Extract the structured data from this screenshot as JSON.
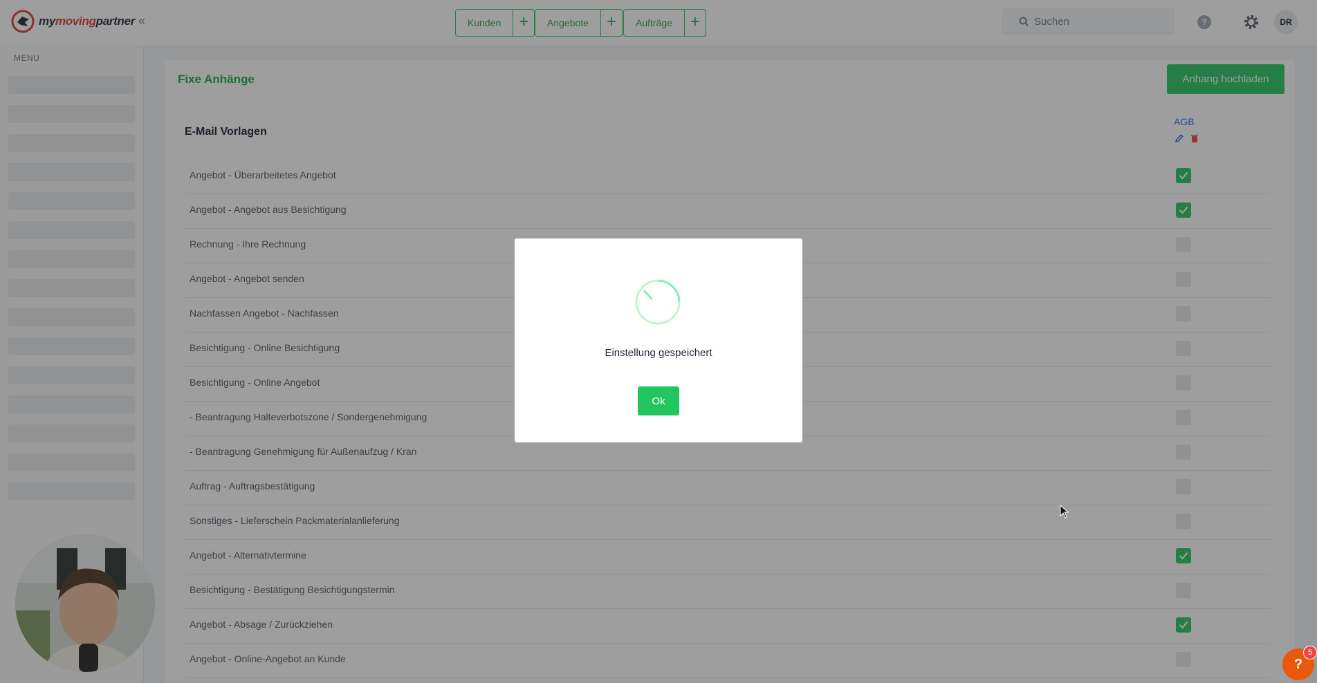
{
  "brand": {
    "name_part1": "my",
    "name_part2": "moving",
    "name_part3": "partner"
  },
  "topnav": {
    "groups": [
      {
        "label": "Kunden"
      },
      {
        "label": "Angebote"
      },
      {
        "label": "Aufträge"
      }
    ],
    "search_placeholder": "Suchen",
    "help_label": "?",
    "avatar_initials": "DR"
  },
  "sidebar": {
    "menu_title": "MENU"
  },
  "page": {
    "title": "Fixe Anhänge",
    "upload_button": "Anhang hochladen",
    "section_title": "E-Mail Vorlagen",
    "column_header": "AGB",
    "templates": [
      {
        "label": "Angebot - Überarbeitetes Angebot",
        "checked": true
      },
      {
        "label": "Angebot - Angebot aus Besichtigung",
        "checked": true
      },
      {
        "label": "Rechnung - Ihre Rechnung",
        "checked": false
      },
      {
        "label": "Angebot - Angebot senden",
        "checked": false
      },
      {
        "label": "Nachfassen Angebot - Nachfassen",
        "checked": false
      },
      {
        "label": "Besichtigung - Online Besichtigung",
        "checked": false
      },
      {
        "label": "Besichtigung - Online Angebot",
        "checked": false
      },
      {
        "label": "- Beantragung Halteverbotszone / Sondergenehmigung",
        "checked": false
      },
      {
        "label": "- Beantragung Genehmigung für Außenaufzug / Kran",
        "checked": false
      },
      {
        "label": "Auftrag - Auftragsbestätigung",
        "checked": false
      },
      {
        "label": "Sonstiges - Lieferschein Packmaterialanlieferung",
        "checked": false
      },
      {
        "label": "Angebot - Alternativtermine",
        "checked": true
      },
      {
        "label": "Besichtigung - Bestätigung Besichtigungstermin",
        "checked": false
      },
      {
        "label": "Angebot - Absage / Zurückziehen",
        "checked": true
      },
      {
        "label": "Angebot - Online-Angebot an Kunde",
        "checked": false
      }
    ]
  },
  "modal": {
    "message": "Einstellung gespeichert",
    "ok_label": "Ok"
  },
  "support": {
    "icon_label": "?",
    "badge_count": "5"
  },
  "colors": {
    "accent": "#22c55e",
    "accent_text": "#16a34a",
    "link": "#2563eb",
    "danger": "#ef4444",
    "support": "#ea580c"
  }
}
